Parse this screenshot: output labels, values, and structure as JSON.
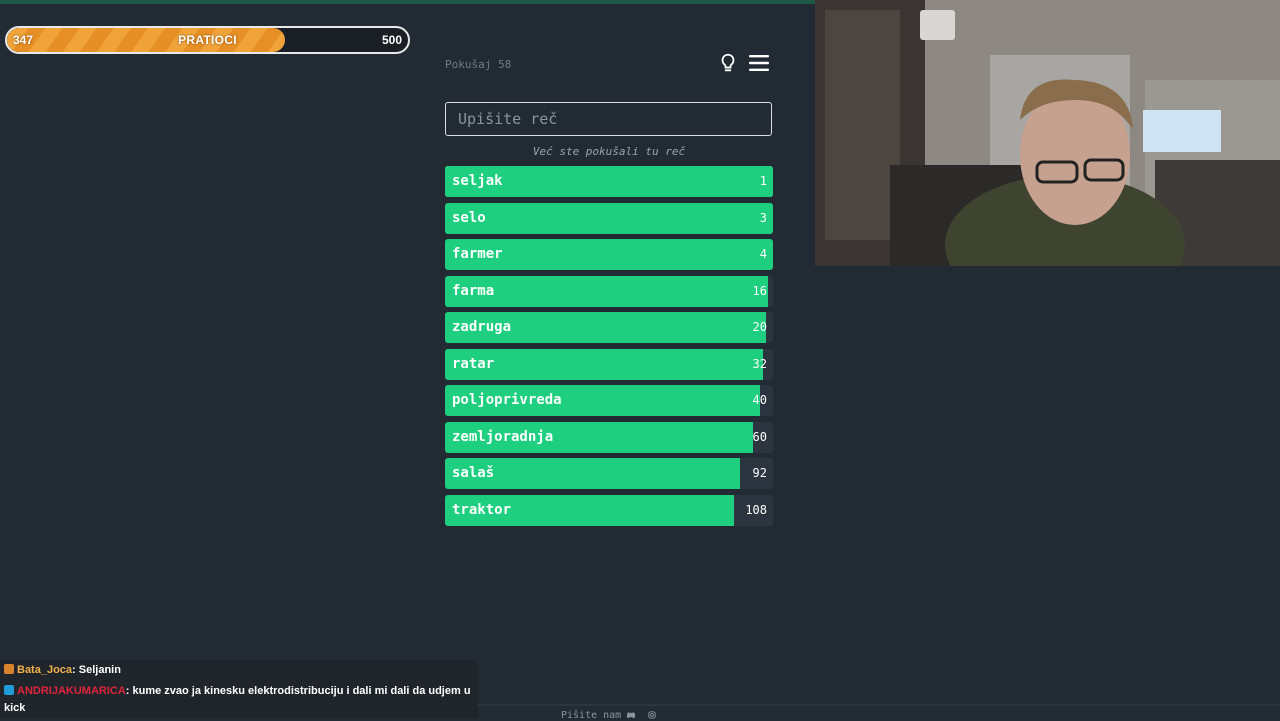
{
  "followers": {
    "current": "347",
    "label": "PRATIOCI",
    "goal": "500",
    "fraction": 0.694
  },
  "game": {
    "attempt_label": "Pokušaj 58",
    "input_placeholder": "Upišite reč",
    "notice": "Već ste pokušali tu reč",
    "guesses": [
      {
        "word": "seljak",
        "rank": "1",
        "fill": 1.0,
        "active": true
      },
      {
        "word": "selo",
        "rank": "3",
        "fill": 1.0
      },
      {
        "word": "farmer",
        "rank": "4",
        "fill": 1.0
      },
      {
        "word": "farma",
        "rank": "16",
        "fill": 0.985
      },
      {
        "word": "zadruga",
        "rank": "20",
        "fill": 0.98
      },
      {
        "word": "ratar",
        "rank": "32",
        "fill": 0.97
      },
      {
        "word": "poljoprivreda",
        "rank": "40",
        "fill": 0.96
      },
      {
        "word": "zemljoradnja",
        "rank": "60",
        "fill": 0.94
      },
      {
        "word": "salaš",
        "rank": "92",
        "fill": 0.9
      },
      {
        "word": "traktor",
        "rank": "108",
        "fill": 0.88
      }
    ]
  },
  "chat": [
    {
      "user": "Bata_Joca",
      "message": ": Seljanin",
      "user_color": "#f2b24c",
      "badge_color": "#d9822b"
    },
    {
      "user": "ANDRIJAKUMARICA",
      "message": ": kume zvao ja kinesku elektrodistribuciju i dali mi dali da udjem u kick",
      "user_color": "#e0243a",
      "badge_color": "#1f9bd8"
    }
  ],
  "footer": {
    "text": "Pišite nam"
  },
  "icons": [
    "lightbulb-icon",
    "menu-icon",
    "discord-icon",
    "instagram-icon"
  ]
}
